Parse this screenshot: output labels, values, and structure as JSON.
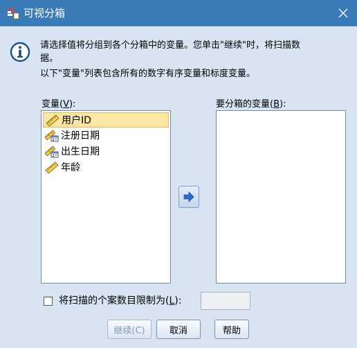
{
  "window": {
    "title": "可视分箱"
  },
  "info": {
    "line1": "请选择值将分组到各个分箱中的变量。您单击\"继续\"时，将扫描数",
    "line2": "据。",
    "line3": "以下\"变量\"列表包含所有的数字有序变量和标度变量。"
  },
  "source": {
    "label_text": "变量(",
    "label_key": "V",
    "label_end": "):",
    "items": [
      {
        "label": "用户ID",
        "icon": "ruler-scale-icon"
      },
      {
        "label": "注册日期",
        "icon": "date-scale-icon"
      },
      {
        "label": "出生日期",
        "icon": "date-scale-icon"
      },
      {
        "label": "年龄",
        "icon": "ruler-scale-icon"
      }
    ]
  },
  "target": {
    "label_text": "要分箱的变量(",
    "label_key": "B",
    "label_end": "):",
    "items": []
  },
  "limit": {
    "label_text": "将扫描的个案数目限制为(",
    "label_key": "L",
    "label_end": "):",
    "checked": false,
    "value": ""
  },
  "buttons": {
    "continue": "继续(C)",
    "cancel": "取消",
    "help": "帮助"
  },
  "colors": {
    "titlebar": "#3a7bb7",
    "dialog_bg": "#d8e4f2",
    "selection": "#fbe7a3",
    "arrow": "#2c6bc8"
  }
}
